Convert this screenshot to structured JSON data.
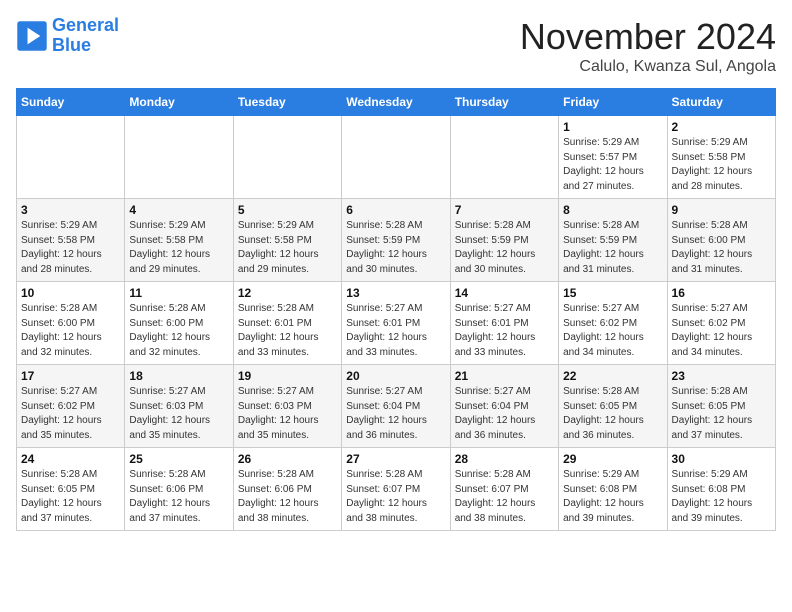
{
  "logo": {
    "line1": "General",
    "line2": "Blue",
    "icon": "▶"
  },
  "title": "November 2024",
  "subtitle": "Calulo, Kwanza Sul, Angola",
  "weekdays": [
    "Sunday",
    "Monday",
    "Tuesday",
    "Wednesday",
    "Thursday",
    "Friday",
    "Saturday"
  ],
  "weeks": [
    [
      {
        "day": "",
        "info": ""
      },
      {
        "day": "",
        "info": ""
      },
      {
        "day": "",
        "info": ""
      },
      {
        "day": "",
        "info": ""
      },
      {
        "day": "",
        "info": ""
      },
      {
        "day": "1",
        "info": "Sunrise: 5:29 AM\nSunset: 5:57 PM\nDaylight: 12 hours\nand 27 minutes."
      },
      {
        "day": "2",
        "info": "Sunrise: 5:29 AM\nSunset: 5:58 PM\nDaylight: 12 hours\nand 28 minutes."
      }
    ],
    [
      {
        "day": "3",
        "info": "Sunrise: 5:29 AM\nSunset: 5:58 PM\nDaylight: 12 hours\nand 28 minutes."
      },
      {
        "day": "4",
        "info": "Sunrise: 5:29 AM\nSunset: 5:58 PM\nDaylight: 12 hours\nand 29 minutes."
      },
      {
        "day": "5",
        "info": "Sunrise: 5:29 AM\nSunset: 5:58 PM\nDaylight: 12 hours\nand 29 minutes."
      },
      {
        "day": "6",
        "info": "Sunrise: 5:28 AM\nSunset: 5:59 PM\nDaylight: 12 hours\nand 30 minutes."
      },
      {
        "day": "7",
        "info": "Sunrise: 5:28 AM\nSunset: 5:59 PM\nDaylight: 12 hours\nand 30 minutes."
      },
      {
        "day": "8",
        "info": "Sunrise: 5:28 AM\nSunset: 5:59 PM\nDaylight: 12 hours\nand 31 minutes."
      },
      {
        "day": "9",
        "info": "Sunrise: 5:28 AM\nSunset: 6:00 PM\nDaylight: 12 hours\nand 31 minutes."
      }
    ],
    [
      {
        "day": "10",
        "info": "Sunrise: 5:28 AM\nSunset: 6:00 PM\nDaylight: 12 hours\nand 32 minutes."
      },
      {
        "day": "11",
        "info": "Sunrise: 5:28 AM\nSunset: 6:00 PM\nDaylight: 12 hours\nand 32 minutes."
      },
      {
        "day": "12",
        "info": "Sunrise: 5:28 AM\nSunset: 6:01 PM\nDaylight: 12 hours\nand 33 minutes."
      },
      {
        "day": "13",
        "info": "Sunrise: 5:27 AM\nSunset: 6:01 PM\nDaylight: 12 hours\nand 33 minutes."
      },
      {
        "day": "14",
        "info": "Sunrise: 5:27 AM\nSunset: 6:01 PM\nDaylight: 12 hours\nand 33 minutes."
      },
      {
        "day": "15",
        "info": "Sunrise: 5:27 AM\nSunset: 6:02 PM\nDaylight: 12 hours\nand 34 minutes."
      },
      {
        "day": "16",
        "info": "Sunrise: 5:27 AM\nSunset: 6:02 PM\nDaylight: 12 hours\nand 34 minutes."
      }
    ],
    [
      {
        "day": "17",
        "info": "Sunrise: 5:27 AM\nSunset: 6:02 PM\nDaylight: 12 hours\nand 35 minutes."
      },
      {
        "day": "18",
        "info": "Sunrise: 5:27 AM\nSunset: 6:03 PM\nDaylight: 12 hours\nand 35 minutes."
      },
      {
        "day": "19",
        "info": "Sunrise: 5:27 AM\nSunset: 6:03 PM\nDaylight: 12 hours\nand 35 minutes."
      },
      {
        "day": "20",
        "info": "Sunrise: 5:27 AM\nSunset: 6:04 PM\nDaylight: 12 hours\nand 36 minutes."
      },
      {
        "day": "21",
        "info": "Sunrise: 5:27 AM\nSunset: 6:04 PM\nDaylight: 12 hours\nand 36 minutes."
      },
      {
        "day": "22",
        "info": "Sunrise: 5:28 AM\nSunset: 6:05 PM\nDaylight: 12 hours\nand 36 minutes."
      },
      {
        "day": "23",
        "info": "Sunrise: 5:28 AM\nSunset: 6:05 PM\nDaylight: 12 hours\nand 37 minutes."
      }
    ],
    [
      {
        "day": "24",
        "info": "Sunrise: 5:28 AM\nSunset: 6:05 PM\nDaylight: 12 hours\nand 37 minutes."
      },
      {
        "day": "25",
        "info": "Sunrise: 5:28 AM\nSunset: 6:06 PM\nDaylight: 12 hours\nand 37 minutes."
      },
      {
        "day": "26",
        "info": "Sunrise: 5:28 AM\nSunset: 6:06 PM\nDaylight: 12 hours\nand 38 minutes."
      },
      {
        "day": "27",
        "info": "Sunrise: 5:28 AM\nSunset: 6:07 PM\nDaylight: 12 hours\nand 38 minutes."
      },
      {
        "day": "28",
        "info": "Sunrise: 5:28 AM\nSunset: 6:07 PM\nDaylight: 12 hours\nand 38 minutes."
      },
      {
        "day": "29",
        "info": "Sunrise: 5:29 AM\nSunset: 6:08 PM\nDaylight: 12 hours\nand 39 minutes."
      },
      {
        "day": "30",
        "info": "Sunrise: 5:29 AM\nSunset: 6:08 PM\nDaylight: 12 hours\nand 39 minutes."
      }
    ]
  ]
}
